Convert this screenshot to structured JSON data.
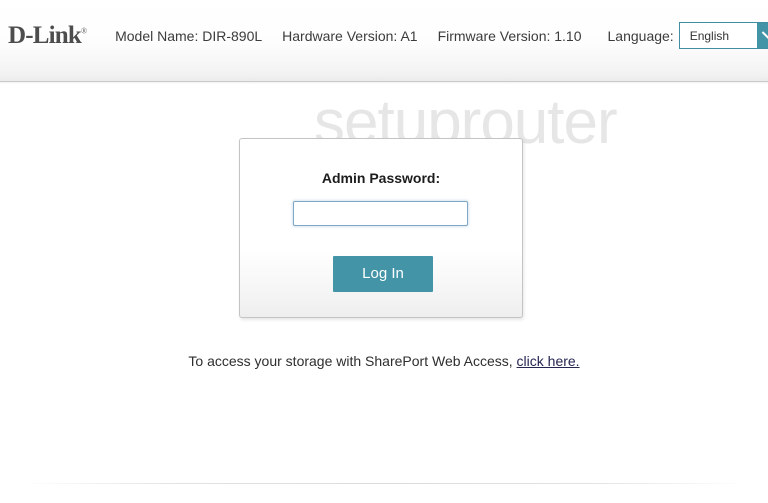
{
  "header": {
    "logo_text": "D-Link",
    "logo_reg_mark": "®",
    "info": [
      {
        "label": "Model Name: DIR-890L"
      },
      {
        "label": "Hardware Version: A1"
      },
      {
        "label": "Firmware Version: 1.10"
      }
    ],
    "language": {
      "label": "Language:",
      "selected": "English",
      "options": [
        "English"
      ],
      "arrow_icon": "chevron-down-icon",
      "accent_color": "#4294a6"
    }
  },
  "watermark": {
    "text": "setuprouter",
    "color": "#e6e6e6"
  },
  "login": {
    "password_label": "Admin Password:",
    "password_value": "",
    "password_placeholder": "",
    "submit_label": "Log In",
    "submit_color": "#4294a6",
    "input_focus_border": "#7fa7c6"
  },
  "footer": {
    "note_prefix": "To access your storage with SharePort Web Access,",
    "note_link": "click here.",
    "link_color": "#252552"
  }
}
